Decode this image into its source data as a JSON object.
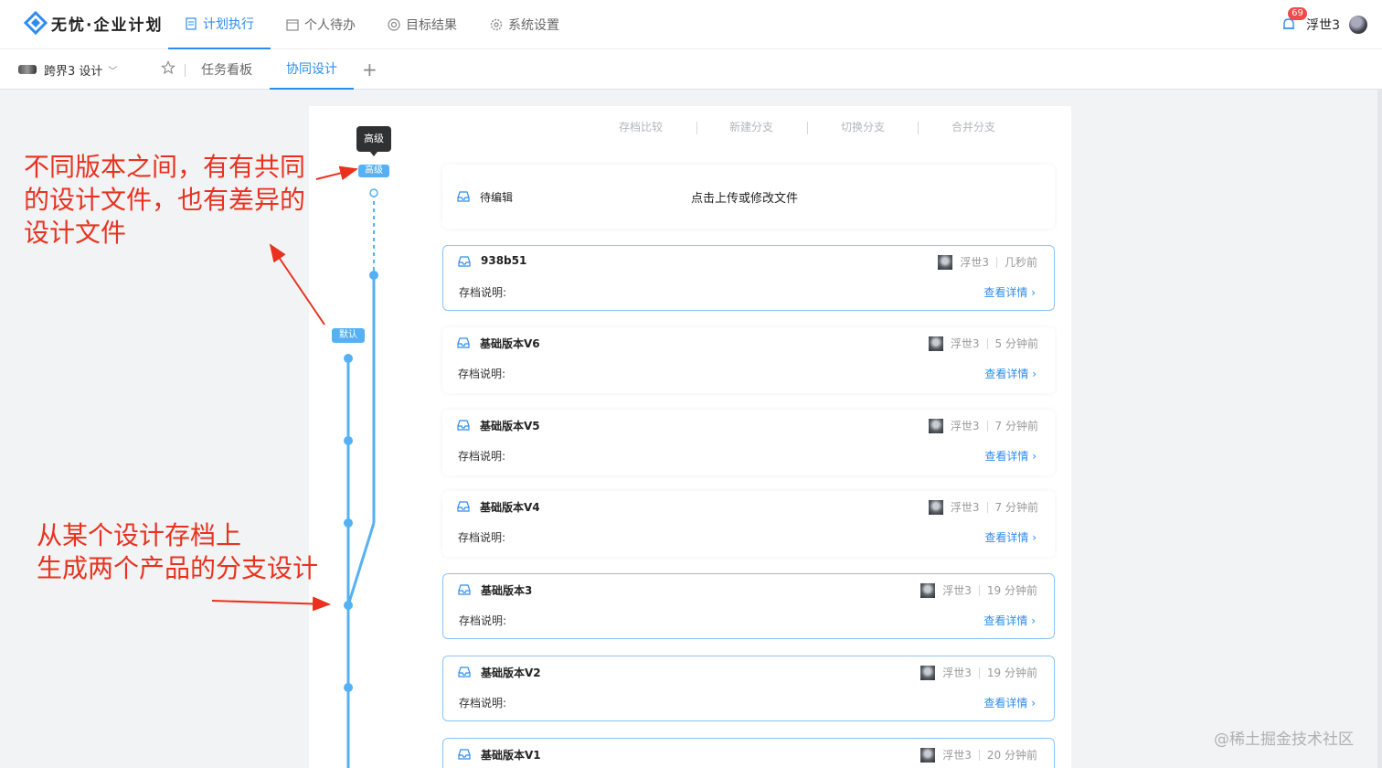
{
  "app": {
    "brand": "无忧·企业计划",
    "nav": [
      "计划执行",
      "个人待办",
      "目标结果",
      "系统设置"
    ],
    "notification_count": "69",
    "user": "浮世3"
  },
  "subnav": {
    "project": "跨界3 设计",
    "tabs": [
      "任务看板",
      "协同设计"
    ]
  },
  "toolbar": [
    "存档比较",
    "新建分支",
    "切换分支",
    "合并分支"
  ],
  "timeline": {
    "tooltip": "高级",
    "branch_tag": "高级",
    "default_tag": "默认"
  },
  "pending": {
    "title": "待编辑",
    "action": "点击上传或修改文件"
  },
  "common": {
    "desc_label": "存档说明:",
    "detail_link": "查看详情 ›"
  },
  "archives": [
    {
      "title": "938b51",
      "user": "浮世3",
      "time": "几秒前"
    },
    {
      "title": "基础版本V6",
      "user": "浮世3",
      "time": "5 分钟前"
    },
    {
      "title": "基础版本V5",
      "user": "浮世3",
      "time": "7 分钟前"
    },
    {
      "title": "基础版本V4",
      "user": "浮世3",
      "time": "7 分钟前"
    },
    {
      "title": "基础版本3",
      "user": "浮世3",
      "time": "19 分钟前"
    },
    {
      "title": "基础版本V2",
      "user": "浮世3",
      "time": "19 分钟前"
    },
    {
      "title": "基础版本V1",
      "user": "浮世3",
      "time": "20 分钟前"
    }
  ],
  "annotations": {
    "top": [
      "不同版本之间，有有共同",
      "的设计文件，也有差异的",
      "设计文件"
    ],
    "bottom": [
      "从某个设计存档上",
      "生成两个产品的分支设计"
    ]
  },
  "watermark": "@稀土掘金技术社区",
  "colors": {
    "accent": "#2e8cf0",
    "timeline": "#55b1f3",
    "annotation": "#e8321f"
  }
}
